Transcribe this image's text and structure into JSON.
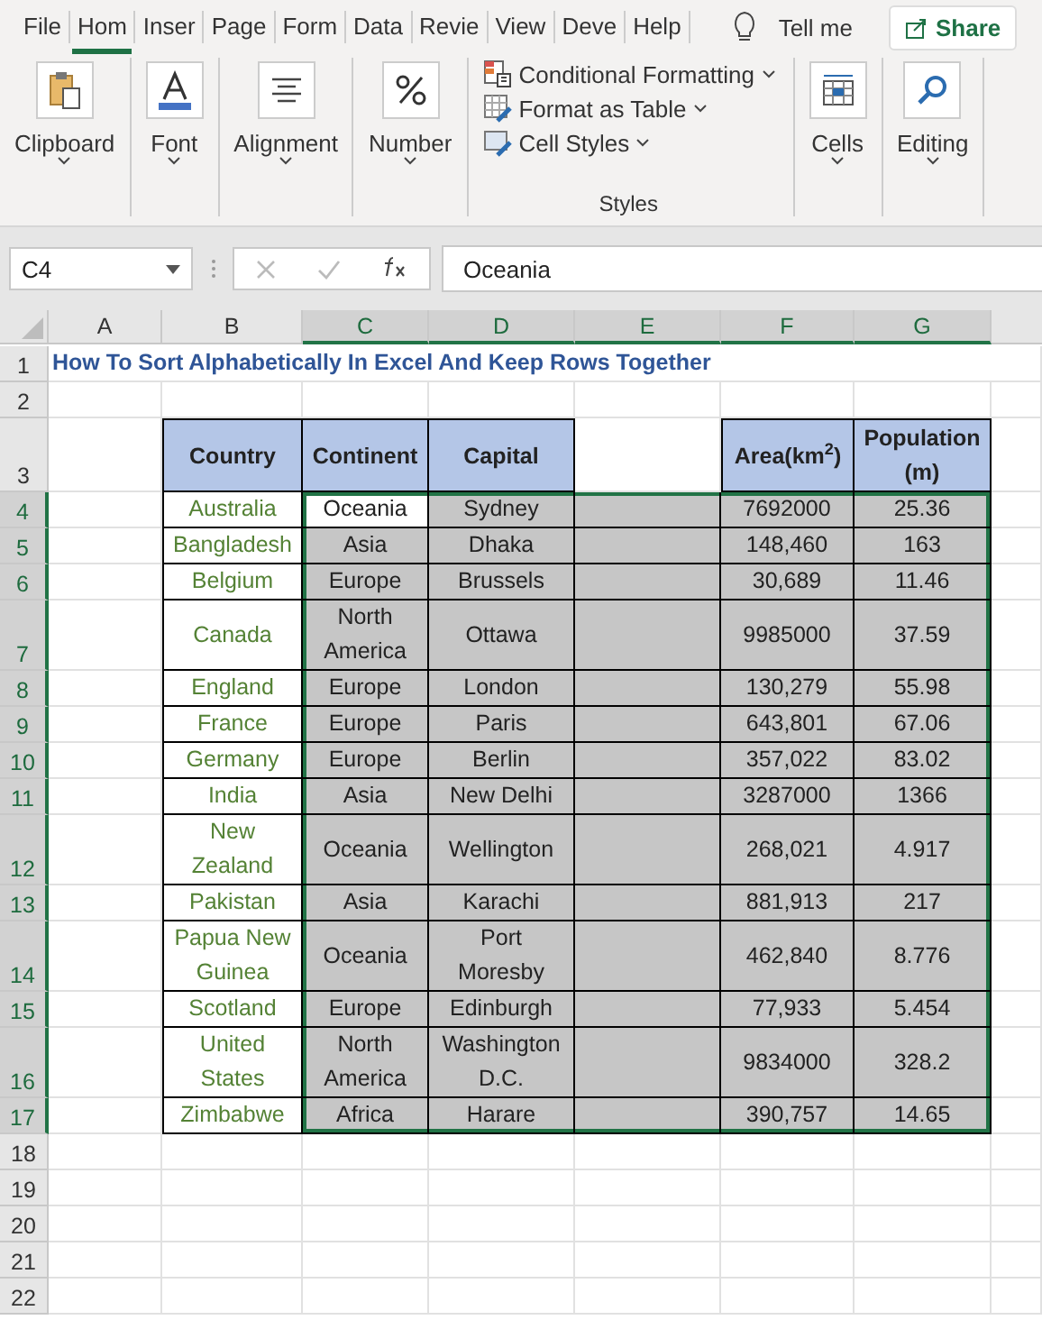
{
  "ribbon": {
    "tabs": [
      {
        "label": "File",
        "selected": false
      },
      {
        "label": "Hom",
        "selected": true
      },
      {
        "label": "Inser",
        "selected": false
      },
      {
        "label": "Page",
        "selected": false
      },
      {
        "label": "Form",
        "selected": false
      },
      {
        "label": "Data",
        "selected": false
      },
      {
        "label": "Revie",
        "selected": false
      },
      {
        "label": "View",
        "selected": false
      },
      {
        "label": "Deve",
        "selected": false
      },
      {
        "label": "Help",
        "selected": false
      }
    ],
    "tell_me": "Tell me",
    "share": "Share",
    "groups": [
      {
        "kind": "big",
        "label": "Clipboard"
      },
      {
        "kind": "big",
        "label": "Font"
      },
      {
        "kind": "big",
        "label": "Alignment"
      },
      {
        "kind": "big",
        "label": "Number"
      },
      {
        "kind": "list",
        "label": "Styles",
        "items": [
          "Conditional Formatting",
          "Format as Table",
          "Cell Styles"
        ]
      },
      {
        "kind": "big",
        "label": "Cells"
      },
      {
        "kind": "big",
        "label": "Editing"
      }
    ]
  },
  "formula_bar": {
    "name_box": "C4",
    "formula": "Oceania"
  },
  "sheet": {
    "columns": [
      {
        "label": "A",
        "selected": false
      },
      {
        "label": "B",
        "selected": false
      },
      {
        "label": "C",
        "selected": true
      },
      {
        "label": "D",
        "selected": true
      },
      {
        "label": "E",
        "selected": true
      },
      {
        "label": "F",
        "selected": true
      },
      {
        "label": "G",
        "selected": true
      }
    ],
    "title": "How To Sort Alphabetically In Excel And Keep Rows Together",
    "headers": [
      "Country",
      "Continent",
      "Capital",
      "Area(km$^{2}$)",
      "Population (m)"
    ],
    "rows": [
      {
        "country": "Australia",
        "continent": "Oceania",
        "capital": "Sydney",
        "area": "7692000",
        "population": "25.36",
        "selected": true,
        "active": true
      },
      {
        "country": "Bangladesh",
        "continent": "Asia",
        "capital": "Dhaka",
        "area": "148,460",
        "population": "163",
        "selected": true,
        "active": false
      },
      {
        "country": "Belgium",
        "continent": "Europe",
        "capital": "Brussels",
        "area": "30,689",
        "population": "11.46",
        "selected": true,
        "active": false
      },
      {
        "country": "Canada",
        "continent": "North America",
        "capital": "Ottawa",
        "area": "9985000",
        "population": "37.59",
        "selected": true,
        "active": false
      },
      {
        "country": "England",
        "continent": "Europe",
        "capital": "London",
        "area": "130,279",
        "population": "55.98",
        "selected": true,
        "active": false
      },
      {
        "country": "France",
        "continent": "Europe",
        "capital": "Paris",
        "area": "643,801",
        "population": "67.06",
        "selected": true,
        "active": false
      },
      {
        "country": "Germany",
        "continent": "Europe",
        "capital": "Berlin",
        "area": "357,022",
        "population": "83.02",
        "selected": true,
        "active": false
      },
      {
        "country": "India",
        "continent": "Asia",
        "capital": "New Delhi",
        "area": "3287000",
        "population": "1366",
        "selected": true,
        "active": false
      },
      {
        "country": "New Zealand",
        "continent": "Oceania",
        "capital": "Wellington",
        "area": "268,021",
        "population": "4.917",
        "selected": true,
        "active": false
      },
      {
        "country": "Pakistan",
        "continent": "Asia",
        "capital": "Karachi",
        "area": "881,913",
        "population": "217",
        "selected": true,
        "active": false
      },
      {
        "country": "Papua New Guinea",
        "continent": "Oceania",
        "capital": "Port Moresby",
        "area": "462,840",
        "population": "8.776",
        "selected": true,
        "active": false
      },
      {
        "country": "Scotland",
        "continent": "Europe",
        "capital": "Edinburgh",
        "area": "77,933",
        "population": "5.454",
        "selected": true,
        "active": false
      },
      {
        "country": "United States",
        "continent": "North America",
        "capital": "Washington D.C.",
        "area": "9834000",
        "population": "328.2",
        "selected": true,
        "active": false
      },
      {
        "country": "Zimbabwe",
        "continent": "Africa",
        "capital": "Harare",
        "area": "390,757",
        "population": "14.65",
        "selected": true,
        "active": false
      }
    ],
    "row_numbers": [
      {
        "label": "1",
        "selected": false
      },
      {
        "label": "2",
        "selected": false
      },
      {
        "label": "3",
        "selected": false
      },
      {
        "label": "4",
        "selected": true
      },
      {
        "label": "5",
        "selected": true
      },
      {
        "label": "6",
        "selected": true
      },
      {
        "label": "7",
        "selected": true
      },
      {
        "label": "8",
        "selected": true
      },
      {
        "label": "9",
        "selected": true
      },
      {
        "label": "10",
        "selected": true
      },
      {
        "label": "11",
        "selected": true
      },
      {
        "label": "12",
        "selected": true
      },
      {
        "label": "13",
        "selected": true
      },
      {
        "label": "14",
        "selected": true
      },
      {
        "label": "15",
        "selected": true
      },
      {
        "label": "16",
        "selected": true
      },
      {
        "label": "17",
        "selected": true
      },
      {
        "label": "18",
        "selected": false
      },
      {
        "label": "19",
        "selected": false
      },
      {
        "label": "20",
        "selected": false
      },
      {
        "label": "21",
        "selected": false
      },
      {
        "label": "22",
        "selected": false
      }
    ]
  }
}
